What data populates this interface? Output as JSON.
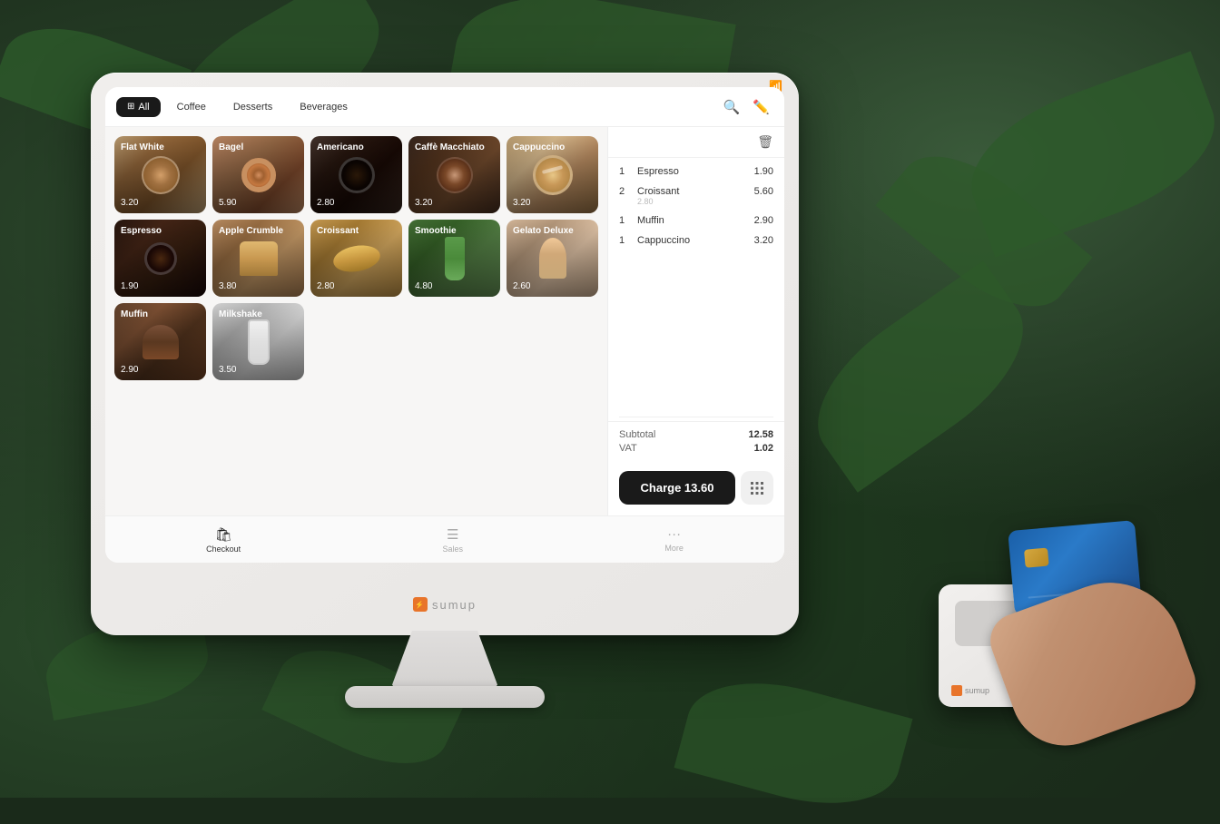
{
  "background": {
    "color": "#1a2a1a"
  },
  "monitor": {
    "brand": "sumup",
    "wifi_status": "connected"
  },
  "screen": {
    "categories": {
      "all": {
        "label": "All",
        "active": true
      },
      "coffee": {
        "label": "Coffee",
        "active": false
      },
      "desserts": {
        "label": "Desserts",
        "active": false
      },
      "beverages": {
        "label": "Beverages",
        "active": false
      }
    },
    "menu_items": [
      {
        "name": "Flat White",
        "price": "3.20",
        "bg_class": "food-flat-white"
      },
      {
        "name": "Bagel",
        "price": "5.90",
        "bg_class": "food-bagel"
      },
      {
        "name": "Americano",
        "price": "2.80",
        "bg_class": "food-americano"
      },
      {
        "name": "Caffè Macchiato",
        "price": "3.20",
        "bg_class": "food-caffe-macchiato"
      },
      {
        "name": "Cappuccino",
        "price": "3.20",
        "bg_class": "food-cappuccino"
      },
      {
        "name": "Espresso",
        "price": "1.90",
        "bg_class": "food-espresso"
      },
      {
        "name": "Apple Crumble",
        "price": "3.80",
        "bg_class": "food-apple-crumble"
      },
      {
        "name": "Croissant",
        "price": "2.80",
        "bg_class": "food-croissant"
      },
      {
        "name": "Smoothie",
        "price": "4.80",
        "bg_class": "food-smoothie"
      },
      {
        "name": "Gelato Deluxe",
        "price": "2.60",
        "bg_class": "food-gelato"
      },
      {
        "name": "Muffin",
        "price": "2.90",
        "bg_class": "food-muffin"
      },
      {
        "name": "Milkshake",
        "price": "3.50",
        "bg_class": "food-milkshake"
      }
    ],
    "order": {
      "items": [
        {
          "qty": "1",
          "name": "Espresso",
          "price": "1.90"
        },
        {
          "qty": "2",
          "name": "Croissant",
          "subtag": "2.80",
          "price": "5.60"
        },
        {
          "qty": "1",
          "name": "Muffin",
          "price": "2.90"
        },
        {
          "qty": "1",
          "name": "Cappuccino",
          "price": "3.20"
        }
      ],
      "subtotal_label": "Subtotal",
      "subtotal_value": "12.58",
      "vat_label": "VAT",
      "vat_value": "1.02",
      "charge_label": "Charge 13.60"
    },
    "bottom_nav": [
      {
        "label": "Checkout",
        "icon": "🛍",
        "active": true
      },
      {
        "label": "Sales",
        "icon": "☰",
        "active": false
      },
      {
        "label": "More",
        "icon": "⋯",
        "active": false
      }
    ]
  }
}
